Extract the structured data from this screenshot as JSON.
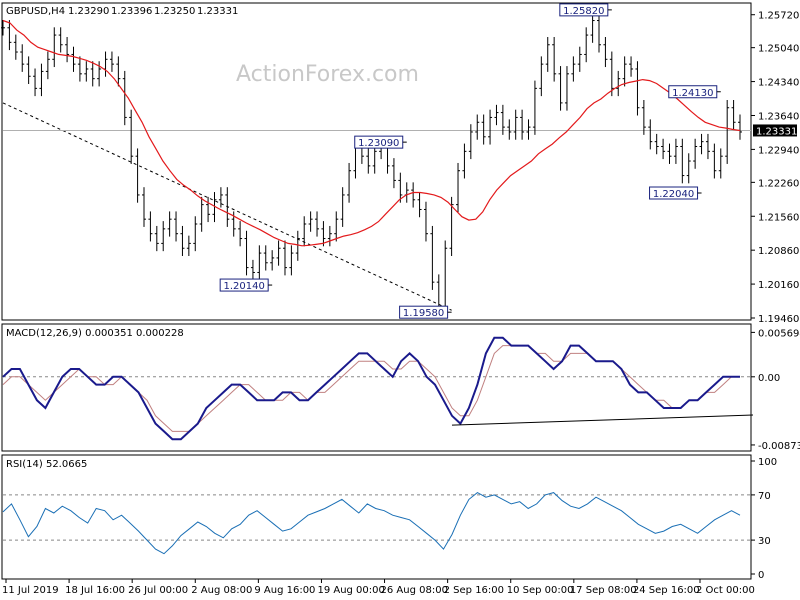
{
  "chart_data": {
    "type": "line",
    "symbol": "GBPUSD,H4",
    "ohlc": [
      "1.23290",
      "1.23396",
      "1.23250",
      "1.23331"
    ],
    "watermark": "ActionForex.com",
    "x_labels": [
      "11 Jul 2019",
      "18 Jul 16:00",
      "26 Jul 00:00",
      "2 Aug 08:00",
      "9 Aug 16:00",
      "19 Aug 00:00",
      "26 Aug 08:00",
      "2 Sep 16:00",
      "10 Sep 00:00",
      "17 Sep 08:00",
      "24 Sep 16:00",
      "2 Oct 00:00"
    ],
    "price": {
      "ylim": [
        1.1946,
        1.259
      ],
      "ticks": [
        "1.25720",
        "1.25040",
        "1.24340",
        "1.23640",
        "1.22940",
        "1.22260",
        "1.21560",
        "1.20860",
        "1.20160",
        "1.19460"
      ],
      "current_label": "1.23331",
      "current_value": 1.23331,
      "series": [
        {
          "name": "price",
          "values": [
            1.2545,
            1.2515,
            1.2495,
            1.247,
            1.2445,
            1.242,
            1.2455,
            1.248,
            1.253,
            1.251,
            1.249,
            1.247,
            1.245,
            1.246,
            1.244,
            1.246,
            1.248,
            1.247,
            1.244,
            1.236,
            1.228,
            1.22,
            1.215,
            1.212,
            1.21,
            1.213,
            1.215,
            1.212,
            1.209,
            1.21,
            1.214,
            1.218,
            1.216,
            1.219,
            1.22,
            1.215,
            1.213,
            1.211,
            1.205,
            1.204,
            1.208,
            1.206,
            1.207,
            1.209,
            1.205,
            1.208,
            1.211,
            1.214,
            1.215,
            1.213,
            1.211,
            1.212,
            1.215,
            1.22,
            1.225,
            1.23,
            1.228,
            1.226,
            1.229,
            1.23,
            1.226,
            1.223,
            1.22,
            1.221,
            1.219,
            1.217,
            1.212,
            1.202,
            1.197,
            1.209,
            1.218,
            1.225,
            1.229,
            1.233,
            1.235,
            1.232,
            1.236,
            1.237,
            1.234,
            1.233,
            1.236,
            1.233,
            1.234,
            1.242,
            1.247,
            1.251,
            1.245,
            1.239,
            1.245,
            1.247,
            1.249,
            1.253,
            1.256,
            1.251,
            1.248,
            1.242,
            1.244,
            1.247,
            1.246,
            1.238,
            1.234,
            1.231,
            1.23,
            1.229,
            1.228,
            1.23,
            1.224,
            1.227,
            1.23,
            1.231,
            1.229,
            1.225,
            1.228,
            1.238,
            1.235,
            1.233
          ]
        },
        {
          "name": "sma",
          "values": [
            1.256,
            1.2555,
            1.254,
            1.253,
            1.2515,
            1.2505,
            1.25,
            1.2495,
            1.249,
            1.2488,
            1.2486,
            1.2482,
            1.2478,
            1.2472,
            1.2465,
            1.2455,
            1.244,
            1.242,
            1.24,
            1.2375,
            1.235,
            1.232,
            1.2295,
            1.227,
            1.225,
            1.2232,
            1.222,
            1.221,
            1.2198,
            1.2188,
            1.218,
            1.2172,
            1.2165,
            1.2158,
            1.215,
            1.2142,
            1.2135,
            1.2128,
            1.212,
            1.2112,
            1.2106,
            1.21,
            1.2098,
            1.2095,
            1.2096,
            1.2098,
            1.21,
            1.2105,
            1.211,
            1.2115,
            1.2118,
            1.2122,
            1.2128,
            1.2135,
            1.2145,
            1.216,
            1.2175,
            1.219,
            1.22,
            1.2205,
            1.2205,
            1.2203,
            1.22,
            1.2195,
            1.2185,
            1.217,
            1.2155,
            1.2148,
            1.215,
            1.2165,
            1.219,
            1.221,
            1.2225,
            1.224,
            1.225,
            1.226,
            1.227,
            1.2285,
            1.2295,
            1.2305,
            1.2318,
            1.233,
            1.2345,
            1.236,
            1.2378,
            1.239,
            1.2398,
            1.241,
            1.242,
            1.2428,
            1.2432,
            1.2435,
            1.2438,
            1.2436,
            1.243,
            1.242,
            1.241,
            1.2398,
            1.2385,
            1.2372,
            1.236,
            1.235,
            1.2345,
            1.234,
            1.2338,
            1.2335,
            1.2333
          ]
        }
      ],
      "annotations": [
        {
          "label": "1.25820",
          "value": 1.2582,
          "index": 95,
          "side": "left"
        },
        {
          "label": "1.24130",
          "value": 1.2413,
          "index": 112,
          "side": "left"
        },
        {
          "label": "1.23090",
          "value": 1.2309,
          "index": 63,
          "side": "left"
        },
        {
          "label": "1.22040",
          "value": 1.2204,
          "index": 109,
          "side": "left"
        },
        {
          "label": "1.20140",
          "value": 1.2014,
          "index": 42,
          "side": "left"
        },
        {
          "label": "1.19580",
          "value": 1.1958,
          "index": 70,
          "side": "left"
        }
      ]
    },
    "macd": {
      "label": "MACD(12,26,9) 0.000351 0.000228",
      "ylim": [
        -0.009,
        0.006
      ],
      "ticks": [
        "0.005694",
        "0.00",
        "-0.008737"
      ],
      "series": [
        {
          "name": "macd",
          "values": [
            0.0,
            0.001,
            0.001,
            -0.001,
            -0.003,
            -0.004,
            -0.002,
            0.0,
            0.001,
            0.001,
            0.0,
            -0.001,
            -0.001,
            0.0,
            0.0,
            -0.001,
            -0.002,
            -0.004,
            -0.006,
            -0.007,
            -0.008,
            -0.008,
            -0.007,
            -0.006,
            -0.004,
            -0.003,
            -0.002,
            -0.001,
            -0.001,
            -0.002,
            -0.003,
            -0.003,
            -0.003,
            -0.002,
            -0.002,
            -0.003,
            -0.003,
            -0.002,
            -0.001,
            0.0,
            0.001,
            0.002,
            0.003,
            0.003,
            0.002,
            0.001,
            0.0,
            0.002,
            0.003,
            0.002,
            0.0,
            -0.001,
            -0.003,
            -0.005,
            -0.006,
            -0.004,
            -0.001,
            0.003,
            0.005,
            0.005,
            0.004,
            0.004,
            0.004,
            0.003,
            0.002,
            0.001,
            0.002,
            0.004,
            0.004,
            0.003,
            0.002,
            0.002,
            0.002,
            0.001,
            -0.001,
            -0.002,
            -0.002,
            -0.003,
            -0.004,
            -0.004,
            -0.004,
            -0.003,
            -0.003,
            -0.002,
            -0.001,
            0.0,
            0.0,
            0.0
          ]
        },
        {
          "name": "signal",
          "values": [
            -0.001,
            0.0,
            0.0,
            -0.001,
            -0.002,
            -0.003,
            -0.002,
            -0.001,
            0.0,
            0.001,
            0.0,
            0.0,
            -0.001,
            -0.001,
            0.0,
            -0.001,
            -0.002,
            -0.003,
            -0.005,
            -0.006,
            -0.007,
            -0.007,
            -0.007,
            -0.006,
            -0.005,
            -0.004,
            -0.003,
            -0.002,
            -0.001,
            -0.001,
            -0.002,
            -0.003,
            -0.003,
            -0.003,
            -0.002,
            -0.002,
            -0.003,
            -0.002,
            -0.002,
            -0.001,
            0.0,
            0.001,
            0.002,
            0.002,
            0.002,
            0.002,
            0.001,
            0.001,
            0.002,
            0.002,
            0.001,
            0.0,
            -0.002,
            -0.004,
            -0.005,
            -0.005,
            -0.003,
            0.0,
            0.003,
            0.004,
            0.004,
            0.004,
            0.004,
            0.003,
            0.003,
            0.002,
            0.002,
            0.003,
            0.003,
            0.003,
            0.002,
            0.002,
            0.002,
            0.001,
            0.0,
            -0.001,
            -0.002,
            -0.003,
            -0.003,
            -0.004,
            -0.004,
            -0.003,
            -0.003,
            -0.002,
            -0.002,
            -0.001,
            0.0,
            0.0
          ]
        }
      ]
    },
    "rsi": {
      "label": "RSI(14) 52.0665",
      "ylim": [
        0,
        100
      ],
      "ticks": [
        "100",
        "70",
        "30",
        "0"
      ],
      "series": [
        {
          "name": "rsi",
          "values": [
            55,
            62,
            48,
            33,
            42,
            58,
            54,
            60,
            56,
            50,
            45,
            58,
            56,
            48,
            52,
            45,
            38,
            30,
            22,
            18,
            25,
            34,
            40,
            46,
            42,
            36,
            32,
            40,
            44,
            52,
            56,
            50,
            44,
            38,
            40,
            46,
            52,
            55,
            58,
            62,
            66,
            60,
            54,
            62,
            58,
            56,
            52,
            50,
            48,
            42,
            36,
            30,
            22,
            35,
            52,
            66,
            72,
            68,
            70,
            66,
            62,
            64,
            58,
            62,
            70,
            72,
            65,
            60,
            58,
            62,
            68,
            64,
            60,
            56,
            50,
            44,
            40,
            36,
            38,
            42,
            44,
            40,
            36,
            42,
            48,
            52,
            56,
            52
          ]
        }
      ]
    }
  }
}
